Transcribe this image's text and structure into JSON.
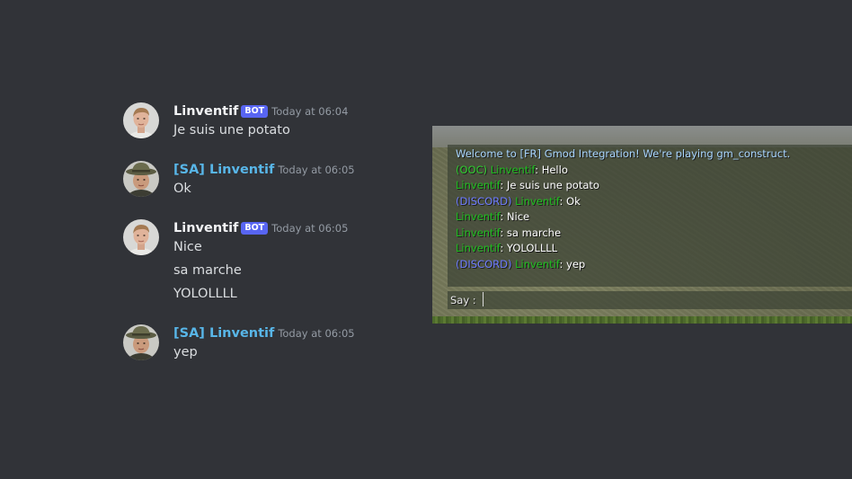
{
  "discord": {
    "bot_tag": "BOT",
    "messages": [
      {
        "username": "Linventif",
        "is_bot": true,
        "timestamp": "Today at 06:04",
        "lines": [
          "Je suis une potato"
        ]
      },
      {
        "username": "[SA] Linventif",
        "is_bot": false,
        "timestamp": "Today at 06:05",
        "lines": [
          "Ok"
        ]
      },
      {
        "username": "Linventif",
        "is_bot": true,
        "timestamp": "Today at 06:05",
        "lines": [
          "Nice",
          "sa marche",
          "YOLOLLLL"
        ]
      },
      {
        "username": "[SA] Linventif",
        "is_bot": false,
        "timestamp": "Today at 06:05",
        "lines": [
          "yep"
        ]
      }
    ],
    "colors": {
      "background": "#313338",
      "username_default": "#f2f3f5",
      "username_sa": "#58b6e8",
      "bot_tag": "#5865f2",
      "timestamp": "#949ba4",
      "message_text": "#dbdee1"
    }
  },
  "gmod": {
    "welcome": "Welcome to [FR] Gmod Integration! We're playing gm_construct.",
    "chat": [
      {
        "prefix": "(OOC) ",
        "name": "Linventif",
        "text": ": Hello"
      },
      {
        "prefix": "",
        "name": "Linventif",
        "text": ": Je suis une potato"
      },
      {
        "prefix": "(DISCORD) ",
        "name": "Linventif",
        "text": ": Ok"
      },
      {
        "prefix": "",
        "name": "Linventif",
        "text": ": Nice"
      },
      {
        "prefix": "",
        "name": "Linventif",
        "text": ": sa marche"
      },
      {
        "prefix": "",
        "name": "Linventif",
        "text": ": YOLOLLLL"
      },
      {
        "prefix": "(DISCORD) ",
        "name": "Linventif",
        "text": ": yep"
      }
    ],
    "say_label": "Say :",
    "say_value": "",
    "colors": {
      "welcome": "#a9d6ff",
      "ooc": "#2ecc2e",
      "name": "#1fbf1f",
      "discord": "#6f7dff",
      "text": "#ffffff"
    }
  }
}
